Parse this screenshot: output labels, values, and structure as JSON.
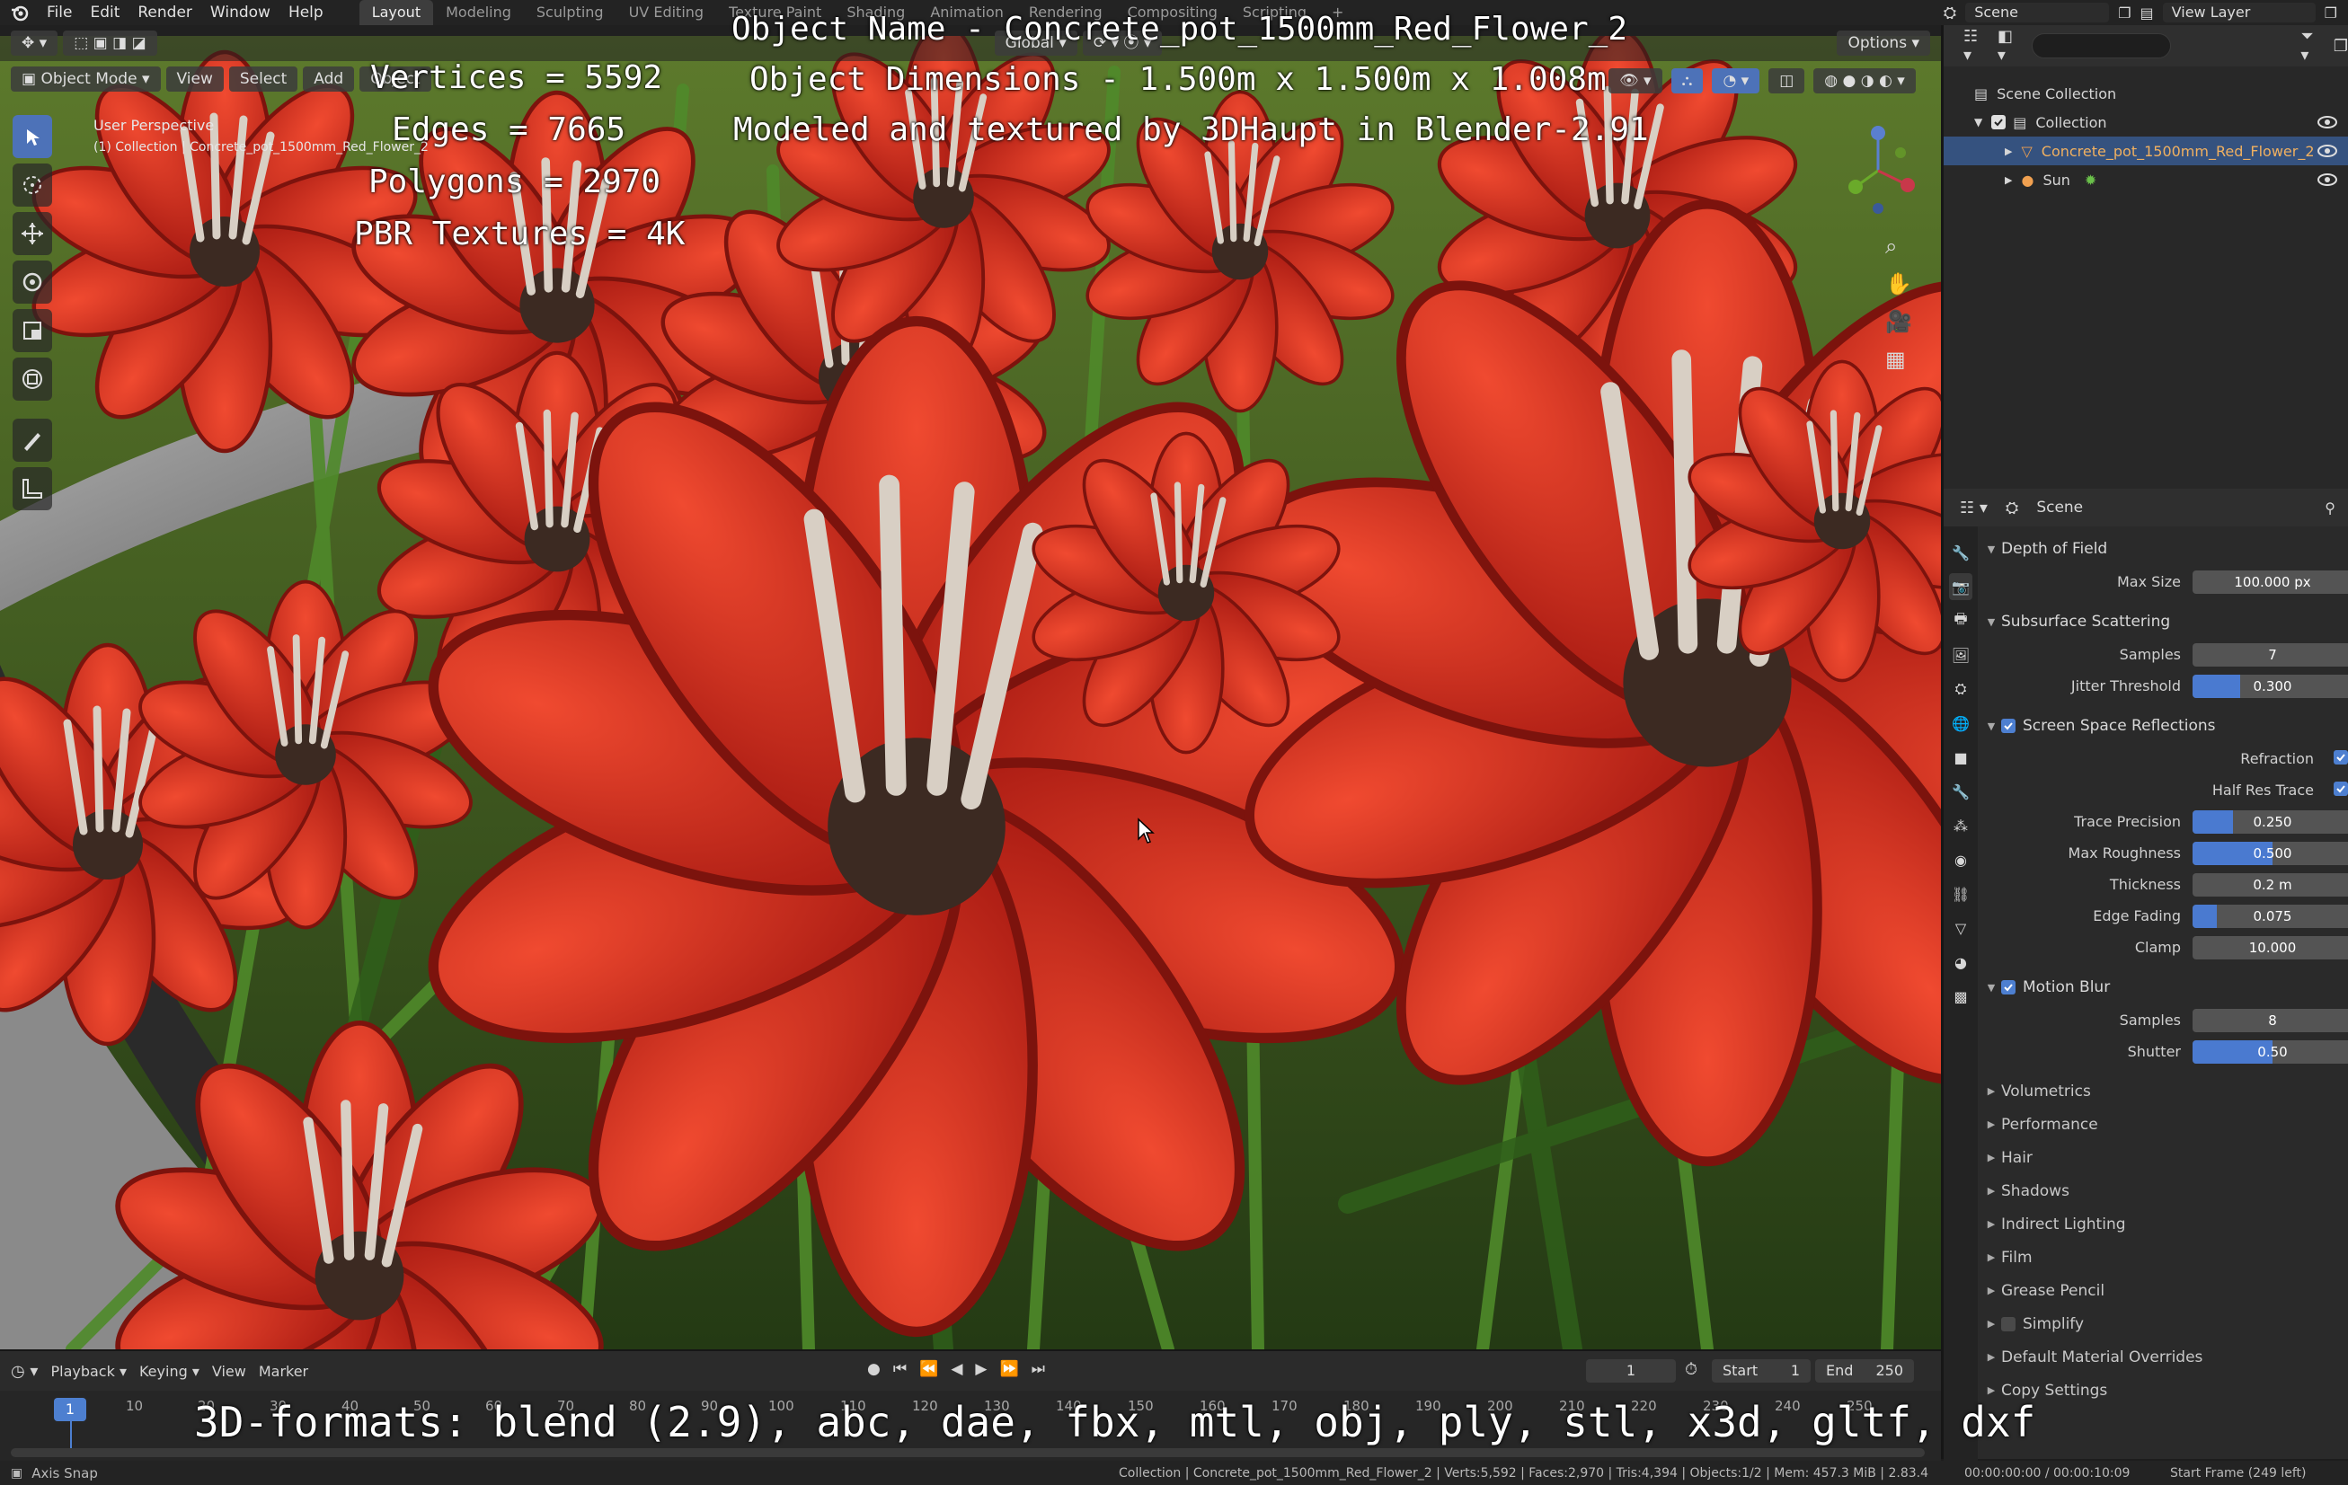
{
  "menu": [
    "File",
    "Edit",
    "Render",
    "Window",
    "Help"
  ],
  "workspaces": [
    "Layout",
    "Modeling",
    "Sculpting",
    "UV Editing",
    "Texture Paint",
    "Shading",
    "Animation",
    "Rendering",
    "Compositing",
    "Scripting"
  ],
  "active_workspace": "Layout",
  "top_right": {
    "scene": "Scene",
    "view_layer": "View Layer"
  },
  "viewport": {
    "mode": "Object Mode",
    "menus": [
      "View",
      "Select",
      "Add",
      "Object"
    ],
    "transform_orientation": "Global",
    "options_label": "Options",
    "perspective": "User Perspective",
    "collection_info": "(1) Collection | Concrete_pot_1500mm_Red_Flower_2"
  },
  "overlay": {
    "object_name": "Object Name - Concrete_pot_1500mm_Red_Flower_2",
    "dimensions": "Object Dimensions -  1.500m x 1.500m x 1.008m",
    "credit": "Modeled and textured by 3DHaupt in Blender-2.91",
    "vertices": "Vertices = 5592",
    "edges": "Edges = 7665",
    "polygons": "Polygons = 2970",
    "textures": "PBR Textures = 4K",
    "formats": "3D-formats: blend (2.9), abc, dae, fbx, mtl, obj, ply, stl, x3d, gltf, dxf"
  },
  "outliner": {
    "root": "Scene Collection",
    "collection": "Collection",
    "items": [
      "Concrete_pot_1500mm_Red_Flower_2",
      "Sun"
    ]
  },
  "properties": {
    "context": "Scene",
    "depth_of_field": {
      "title": "Depth of Field",
      "max_size_label": "Max Size",
      "max_size": "100.000 px"
    },
    "sss": {
      "title": "Subsurface Scattering",
      "samples_label": "Samples",
      "samples": "7",
      "jitter_label": "Jitter Threshold",
      "jitter": "0.300",
      "jitter_frac": 0.3
    },
    "ssr": {
      "title": "Screen Space Reflections",
      "refraction_label": "Refraction",
      "half_res_label": "Half Res Trace",
      "trace_precision_label": "Trace Precision",
      "trace_precision": "0.250",
      "trace_precision_frac": 0.25,
      "max_roughness_label": "Max Roughness",
      "max_roughness": "0.500",
      "max_roughness_frac": 0.5,
      "thickness_label": "Thickness",
      "thickness": "0.2 m",
      "edge_fading_label": "Edge Fading",
      "edge_fading": "0.075",
      "edge_fading_frac": 0.15,
      "clamp_label": "Clamp",
      "clamp": "10.000"
    },
    "motion_blur": {
      "title": "Motion Blur",
      "samples_label": "Samples",
      "samples": "8",
      "shutter_label": "Shutter",
      "shutter": "0.50",
      "shutter_frac": 0.5
    },
    "collapsed": [
      "Volumetrics",
      "Performance",
      "Hair",
      "Shadows",
      "Indirect Lighting",
      "Film",
      "Grease Pencil",
      "Simplify",
      "Default Material Overrides",
      "Copy Settings"
    ]
  },
  "timeline": {
    "menus": [
      "Playback",
      "Keying",
      "View",
      "Marker"
    ],
    "current_frame": "1",
    "start_label": "Start",
    "start": "1",
    "end_label": "End",
    "end": "250",
    "ticks": [
      "10",
      "20",
      "30",
      "40",
      "50",
      "60",
      "70",
      "80",
      "90",
      "100",
      "110",
      "120",
      "130",
      "140",
      "150",
      "160",
      "170",
      "180",
      "190",
      "200",
      "210",
      "220",
      "230",
      "240",
      "250"
    ]
  },
  "statusbar": {
    "left": "Axis Snap",
    "stats": "Collection | Concrete_pot_1500mm_Red_Flower_2 | Verts:5,592 | Faces:2,970 | Tris:4,394 | Objects:1/2 | Mem: 457.3 MiB | 2.83.4",
    "time": "00:00:00:00 / 00:00:10:09",
    "frame": "Start Frame (249 left)"
  },
  "colors": {
    "accent": "#4d7fd0",
    "selection": "#35527f",
    "petal": "#c42a1e",
    "foliage": "#3e6b22"
  }
}
